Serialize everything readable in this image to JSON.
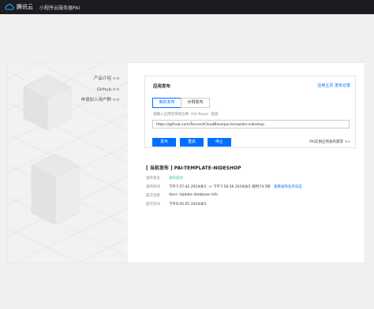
{
  "topbar": {
    "brand": "腾讯云",
    "product": "小程序云服务器PAI"
  },
  "sidebar": {
    "items": [
      {
        "label": "产品介绍 >>"
      },
      {
        "label": "Github >>"
      },
      {
        "label": "申请加入用户群 >>"
      }
    ]
  },
  "deploy": {
    "title": "应用发布",
    "help_link": "应用主页 发布记录",
    "tabs": [
      {
        "label": "我的发布",
        "active": true
      },
      {
        "label": "示例发布",
        "active": false
      }
    ],
    "repo_label": "请输入应用的项目仓库（Git Repo）链接",
    "repo_value": "https://github.com/TencentCloudBase/pai-template-nideshop",
    "buttons": {
      "deploy": "发布",
      "reset": "重启",
      "stop": "停止"
    },
    "request_link": "PAI实例应用发布需求 >>"
  },
  "current": {
    "title": "[ 当前发布 ] PAI-TEMPLATE-NIDESHOP",
    "rows": [
      {
        "key": "发布状态",
        "value": "发布成功"
      },
      {
        "key": "发布时间",
        "value": "下午7:57.42 2019/8/1 -> 下午7:58.56 2019/8/1 耗时74.5秒",
        "link": "查看发布任务日志"
      },
      {
        "key": "提交消息",
        "value": "docs: Update database info"
      },
      {
        "key": "提交时间",
        "value": "下午6:45.05 2019/8/1"
      }
    ]
  },
  "colors": {
    "accent": "#006eff",
    "success": "#29cc85",
    "topbar": "#1b1d22"
  }
}
